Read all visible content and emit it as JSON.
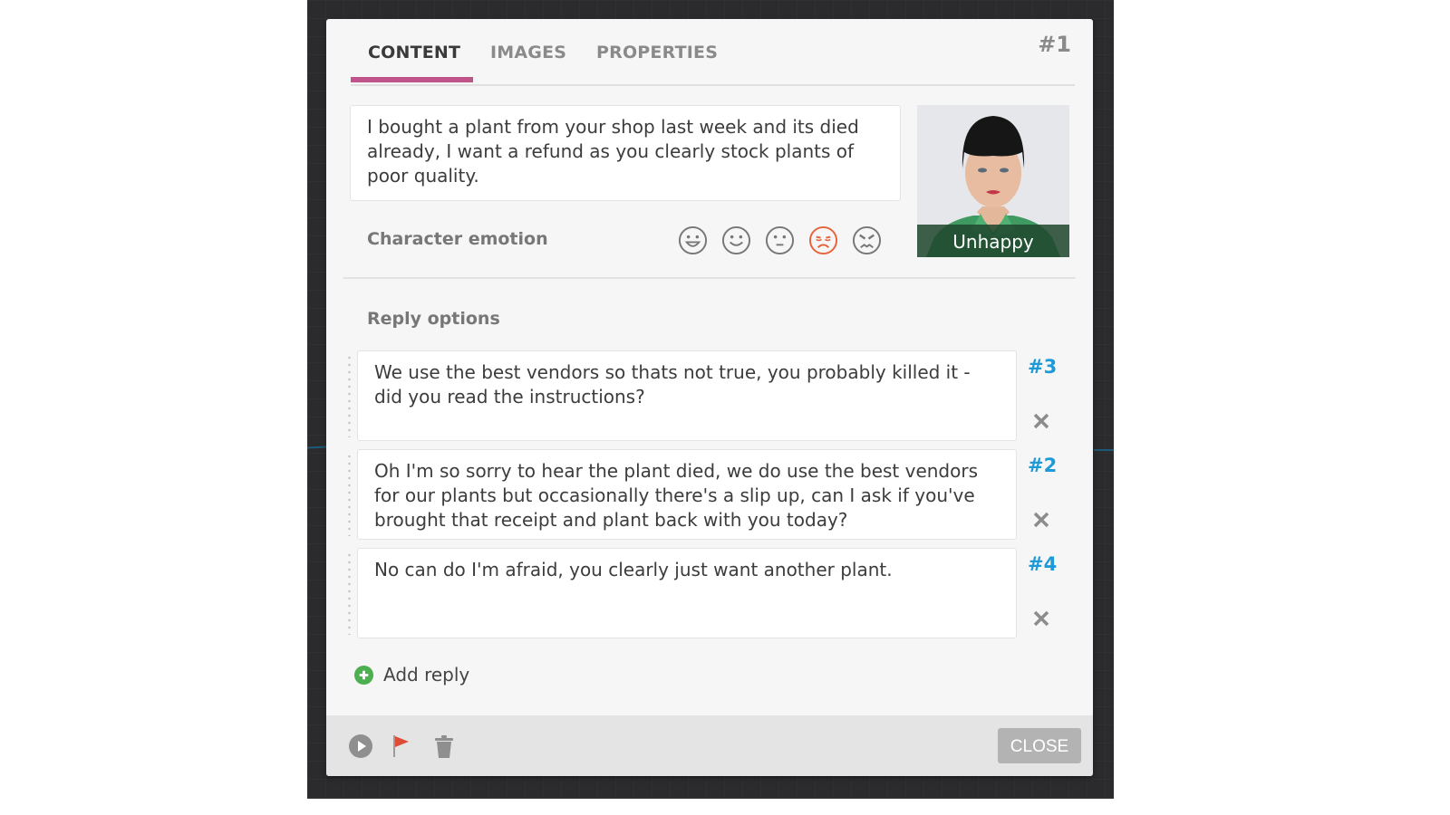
{
  "tabs": [
    {
      "label": "CONTENT",
      "active": true
    },
    {
      "label": "IMAGES",
      "active": false
    },
    {
      "label": "PROPERTIES",
      "active": false
    }
  ],
  "node_id": "#1",
  "message": {
    "text": "I bought a plant from your shop last week and its died already, I want a refund as you clearly stock plants of poor quality."
  },
  "emotion": {
    "label": "Character emotion",
    "options": [
      "very-happy",
      "happy",
      "neutral",
      "unhappy",
      "angry"
    ],
    "selected": "unhappy",
    "selected_color": "#e8623a"
  },
  "portrait": {
    "caption": "Unhappy"
  },
  "replies": {
    "label": "Reply options",
    "items": [
      {
        "text": "We use the best vendors so thats not true, you probably killed it - did you read the instructions?",
        "link": "#3"
      },
      {
        "text": "Oh I'm so sorry to hear the plant died, we do use the best vendors for our plants but occasionally there's a slip up, can I ask if you've brought that receipt and plant back with you today?",
        "link": "#2"
      },
      {
        "text": "No can do I'm afraid, you clearly just want another plant.",
        "link": "#4"
      }
    ],
    "add_label": "Add reply"
  },
  "footer": {
    "close_label": "CLOSE"
  },
  "colors": {
    "accent": "#c0538a",
    "link": "#1e9ad6",
    "flag": "#e04b35",
    "add": "#4caf50"
  }
}
